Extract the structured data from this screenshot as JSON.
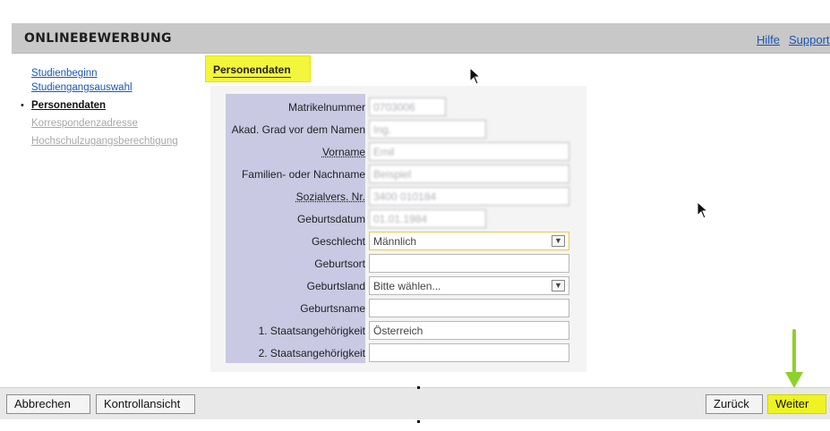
{
  "header": {
    "title": "Onlinebewerbung",
    "links": [
      "Hilfe",
      "Support"
    ]
  },
  "nav": {
    "items": [
      {
        "label": "Studienbeginn",
        "state": "link"
      },
      {
        "label": "Studiengangsauswahl",
        "state": "link"
      },
      {
        "label": "Personendaten",
        "state": "active"
      },
      {
        "label": "Korrespondenzadresse",
        "state": "disabled"
      },
      {
        "label": "Hochschulzugangsberechtigung",
        "state": "disabled"
      }
    ]
  },
  "section": {
    "title": "Personendaten"
  },
  "form": {
    "matrikelnummer": {
      "label": "Matrikelnummer",
      "value": "0703006"
    },
    "akad_grad": {
      "label": "Akad. Grad vor dem Namen",
      "value": "Ing."
    },
    "vorname": {
      "label": "Vorname",
      "value": "Emil"
    },
    "nachname": {
      "label": "Familien- oder Nachname",
      "value": "Beispiel"
    },
    "sozialvers": {
      "label": "Sozialvers. Nr.",
      "value": "3400 010184"
    },
    "geburtsdatum": {
      "label": "Geburtsdatum",
      "value": "01.01.1984"
    },
    "geschlecht": {
      "label": "Geschlecht",
      "value": "Männlich"
    },
    "geburtsort": {
      "label": "Geburtsort",
      "value": ""
    },
    "geburtsland": {
      "label": "Geburtsland",
      "value": "Bitte wählen..."
    },
    "geburtsname": {
      "label": "Geburtsname",
      "value": ""
    },
    "staat1": {
      "label": "1. Staatsangehörigkeit",
      "value": "Österreich"
    },
    "staat2": {
      "label": "2. Staatsangehörigkeit",
      "value": ""
    }
  },
  "footer": {
    "abbrechen": "Abbrechen",
    "kontrollansicht": "Kontrollansicht",
    "zurueck": "Zurück",
    "weiter": "Weiter"
  },
  "colors": {
    "highlight": "#f3f63a",
    "label_column": "#c9c9e3",
    "link": "#1b55b5",
    "annotation_arrow": "#8ed12a"
  }
}
